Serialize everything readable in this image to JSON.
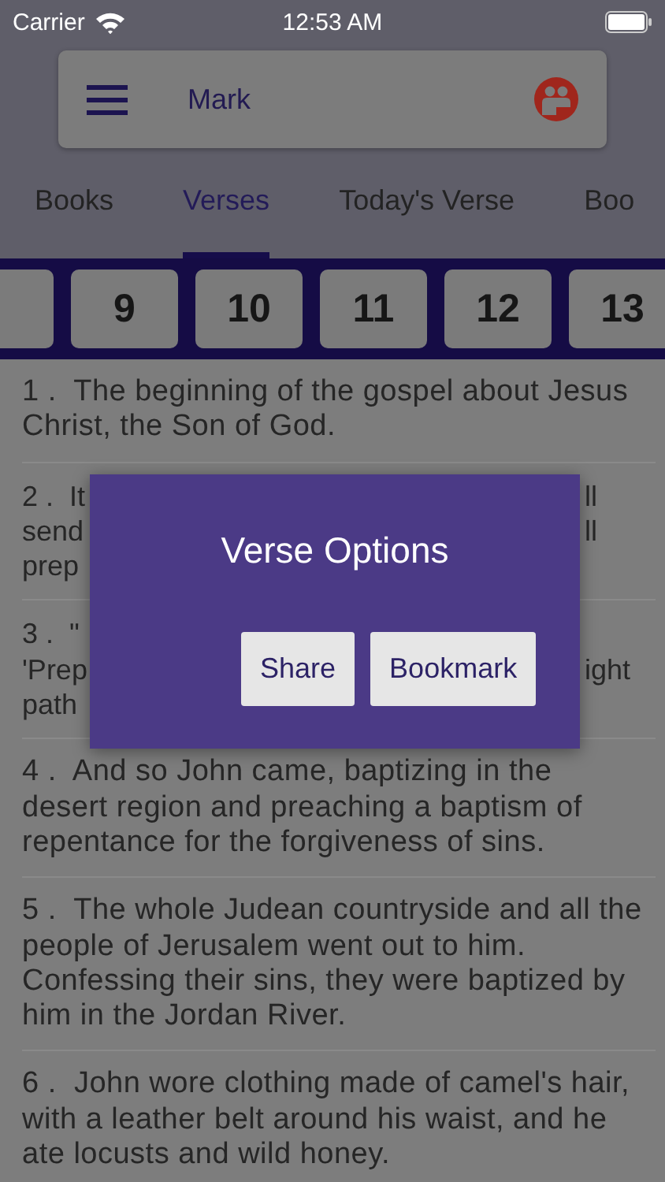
{
  "status_bar": {
    "carrier": "Carrier",
    "time": "12:53 AM"
  },
  "search_bar": {
    "title": "Mark"
  },
  "tabs": [
    {
      "label": "Books",
      "selected": false
    },
    {
      "label": "Verses",
      "selected": true
    },
    {
      "label": "Today's Verse",
      "selected": false
    },
    {
      "label": "Boo",
      "selected": false
    }
  ],
  "verse_numbers": [
    {
      "label": "9",
      "selected": false
    },
    {
      "label": "10",
      "selected": false
    },
    {
      "label": "11",
      "selected": false
    },
    {
      "label": "12",
      "selected": false
    },
    {
      "label": "13",
      "selected": false
    }
  ],
  "verses": [
    {
      "kind": "full",
      "number": "1 .",
      "text": "The beginning of the gospel about Jesus Christ, the Son of God."
    },
    {
      "kind": "covered",
      "number": "2 .",
      "lines": [
        {
          "left": "It",
          "right": "ll"
        },
        {
          "left": "send",
          "right": "ll"
        },
        {
          "left": "prep"
        }
      ]
    },
    {
      "kind": "covered",
      "number": "3 .",
      "lines": [
        {
          "left": "\""
        },
        {
          "left": "'Prep",
          "right": "ight"
        },
        {
          "left": "path"
        }
      ]
    },
    {
      "kind": "full",
      "number": "4 .",
      "text": "And so John came, baptizing in the desert region and preaching a baptism of repentance for the forgiveness of sins."
    },
    {
      "kind": "full",
      "number": "5 .",
      "text": "The whole Judean countryside and all the people of Jerusalem went out to him. Confessing their sins, they were baptized by him in the Jordan River."
    },
    {
      "kind": "full",
      "number": "6 .",
      "text": "John wore clothing made of camel's hair, with a leather belt around his waist, and he ate locusts and wild honey."
    }
  ],
  "dialog": {
    "title": "Verse Options",
    "buttons": [
      "Share",
      "Bookmark"
    ]
  }
}
